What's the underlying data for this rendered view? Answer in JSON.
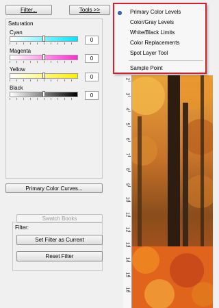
{
  "toolbar": {
    "filter_label": "Filter...",
    "tools_label": "Tools >>"
  },
  "saturation": {
    "title": "Saturation",
    "channels": [
      {
        "label": "Cyan",
        "value": "0",
        "color": "#00e5ff"
      },
      {
        "label": "Magenta",
        "value": "0",
        "color": "#ff2ad4"
      },
      {
        "label": "Yellow",
        "value": "0",
        "color": "#ffee00"
      },
      {
        "label": "Black",
        "value": "0",
        "color": "#000000"
      }
    ]
  },
  "curves_button": "Primary Color Curves...",
  "swatch_button": "Swatch Books",
  "filter_group": {
    "title": "Filter:",
    "set_current": "Set Filter as Current",
    "reset": "Reset Filter"
  },
  "tools_menu": {
    "items": [
      {
        "label": "Primary Color Levels",
        "checked": true
      },
      {
        "label": "Color/Gray Levels"
      },
      {
        "label": "White/Black Limits"
      },
      {
        "label": "Color Replacements"
      },
      {
        "label": "Spot Layer Tool"
      }
    ],
    "extra_item": "Sample Point"
  },
  "ruler": {
    "labels": [
      "2",
      "3",
      "4",
      "5",
      "6",
      "7",
      "8",
      "9",
      "10",
      "11",
      "12",
      "13",
      "14",
      "15",
      "16"
    ]
  },
  "accent": "#d4202c"
}
